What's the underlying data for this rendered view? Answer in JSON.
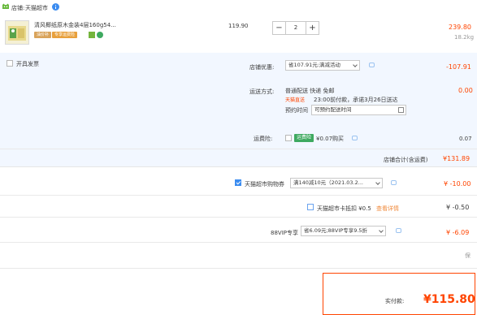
{
  "store": {
    "label": "店铺:",
    "name": "天猫超市",
    "logo_icon": "tmall-cat-icon",
    "info_icon": "info-icon"
  },
  "product": {
    "title": "清风椰纸原木金装4层160g54...",
    "badge_tag": "油价补",
    "badge_service": "专享运费险",
    "tag_icons": [
      "guarantee-icon",
      "green-check-icon"
    ],
    "unit_price": "119.90",
    "quantity": "2",
    "total": "239.80",
    "weight": "18.2kg"
  },
  "invoice": {
    "label": "开具发票"
  },
  "shop_discount": {
    "label": "店铺优惠:",
    "selected": "省107.91元:满减活动",
    "amount": "-107.91"
  },
  "delivery": {
    "label": "运送方式:",
    "type": "普通配送 快递 免邮",
    "fast_tag": "天猫直送",
    "fast_desc": "23:00前付款，承诺3月26日送达",
    "appoint_label": "预约时间",
    "appoint_value": "可预约配送时间",
    "amount": "0.00"
  },
  "shipping_insurance": {
    "label": "运费险:",
    "tag": "运费险",
    "desc": "¥0.07购买",
    "amount": "0.07"
  },
  "store_total": {
    "label": "店铺合计(含运费)",
    "amount": "¥131.89"
  },
  "coupon_row": {
    "label": "天猫超市购物券",
    "selected": "满140减10元（2021.03.2...",
    "amount": "¥ -10.00"
  },
  "card_row": {
    "label": "天猫超市卡抵扣 ¥0.5",
    "link": "查看详情",
    "amount": "¥ -0.50"
  },
  "vip_row": {
    "label": "88VIP专享",
    "selected": "省6.09元;88VIP专享9.5折",
    "amount": "¥ -6.09"
  },
  "last_row": {
    "text": "保"
  },
  "summary": {
    "label": "实付款:",
    "amount": "¥115.80"
  },
  "colors": {
    "accent_red": "#ff4400",
    "panel_blue": "#f2f7ff",
    "checkbox_blue": "#3b8cf0"
  }
}
